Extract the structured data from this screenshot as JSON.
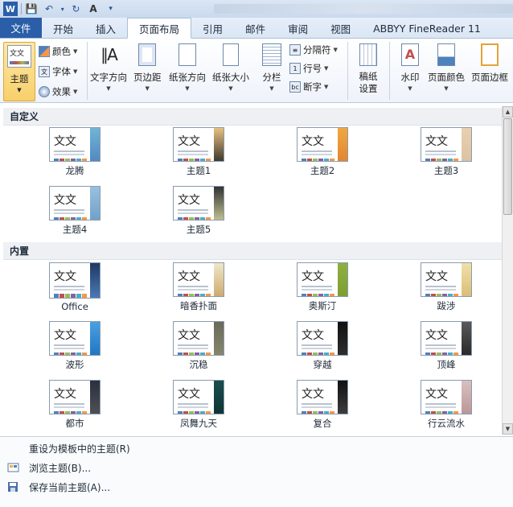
{
  "qat": {
    "undo_arrow": "▾"
  },
  "tabs": [
    "文件",
    "开始",
    "插入",
    "页面布局",
    "引用",
    "邮件",
    "审阅",
    "视图",
    "ABBYY FineReader 11"
  ],
  "ribbon": {
    "theme": "主题",
    "colors": "颜色",
    "fonts": "字体",
    "effects": "效果",
    "text_direction": "文字方向",
    "margins": "页边距",
    "orientation": "纸张方向",
    "size": "纸张大小",
    "columns": "分栏",
    "breaks": "分隔符",
    "line_numbers": "行号",
    "hyphenation": "断字",
    "paper_setup": "稿纸设置",
    "watermark": "水印",
    "page_color": "页面颜色",
    "page_borders": "页面边框"
  },
  "gallery": {
    "custom_header": "自定义",
    "builtin_header": "内置",
    "custom": [
      "龙腾",
      "主题1",
      "主题2",
      "主题3",
      "主题4",
      "主题5"
    ],
    "builtin": [
      "Office",
      "暗香扑面",
      "奥斯汀",
      "跋涉",
      "波形",
      "沉稳",
      "穿越",
      "顶峰",
      "都市",
      "凤舞九天",
      "复合",
      "行云流水"
    ]
  },
  "thumb_text": "文文",
  "menu": {
    "reset": "重设为模板中的主题(R)",
    "browse": "浏览主题(B)...",
    "save": "保存当前主题(A)..."
  }
}
